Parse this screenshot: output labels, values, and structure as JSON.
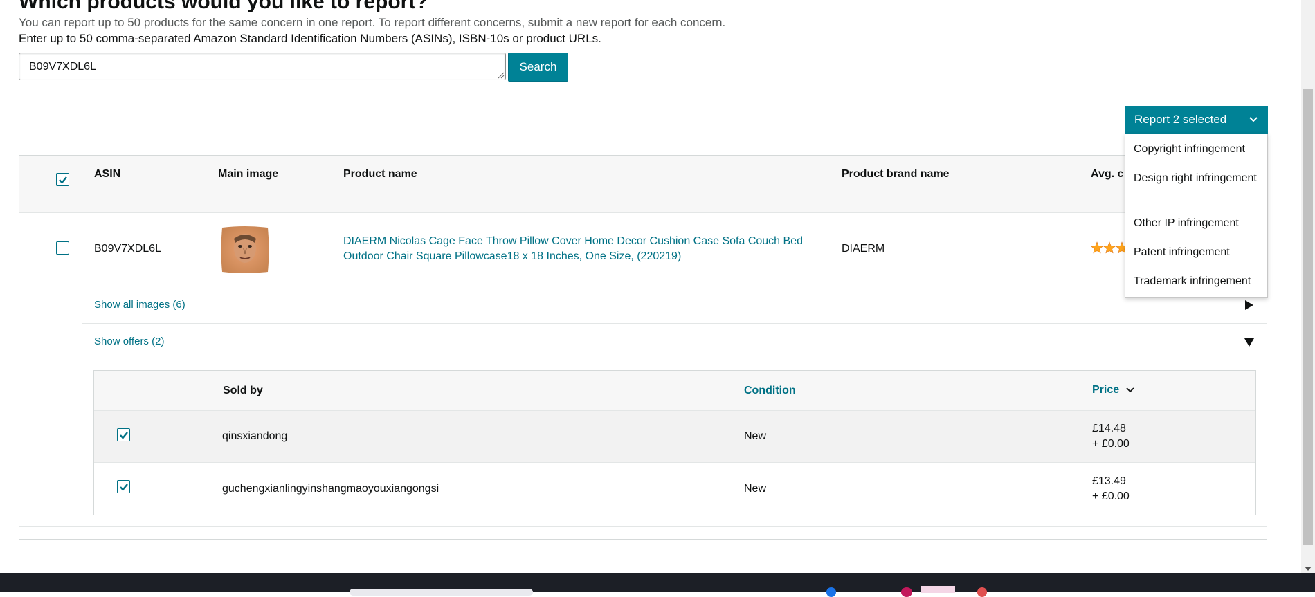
{
  "header": {
    "title": "Which products would you like to report?",
    "info_line1": "You can report up to 50 products for the same concern in one report. To report different concerns, submit a new report for each concern.",
    "info_line2": "Enter up to 50 comma-separated Amazon Standard Identification Numbers (ASINs), ISBN-10s or product URLs."
  },
  "search": {
    "value": "B09V7XDL6L",
    "button_label": "Search"
  },
  "report_dropdown": {
    "button_label": "Report 2 selected",
    "options": [
      "Copyright infringement",
      "Design right infringement",
      "Other IP infringement",
      "Patent infringement",
      "Trademark infringement"
    ]
  },
  "product_table": {
    "headers": {
      "asin": "ASIN",
      "main_image": "Main image",
      "product_name": "Product name",
      "brand": "Product brand name",
      "avg": "Avg. c"
    },
    "row": {
      "asin": "B09V7XDL6L",
      "product_name": "DIAERM Nicolas Cage Face Throw Pillow Cover Home Decor Cushion Case Sofa Couch Bed Outdoor Chair Square Pillowcase18 x 18 Inches, One Size, (220219)",
      "brand": "DIAERM",
      "rating_stars": 3
    },
    "show_images": "Show all images (6)",
    "show_offers": "Show offers (2)"
  },
  "offers_table": {
    "headers": {
      "sold_by": "Sold by",
      "condition": "Condition",
      "price": "Price"
    },
    "rows": [
      {
        "seller": "qinsxiandong",
        "condition": "New",
        "price": "£14.48",
        "shipping": "+ £0.00",
        "checked": true
      },
      {
        "seller": "guchengxianlingyinshangmaoyouxiangongsi",
        "condition": "New",
        "price": "£13.49",
        "shipping": "+ £0.00",
        "checked": true
      }
    ]
  },
  "colors": {
    "accent": "#008296",
    "link": "#007185"
  }
}
